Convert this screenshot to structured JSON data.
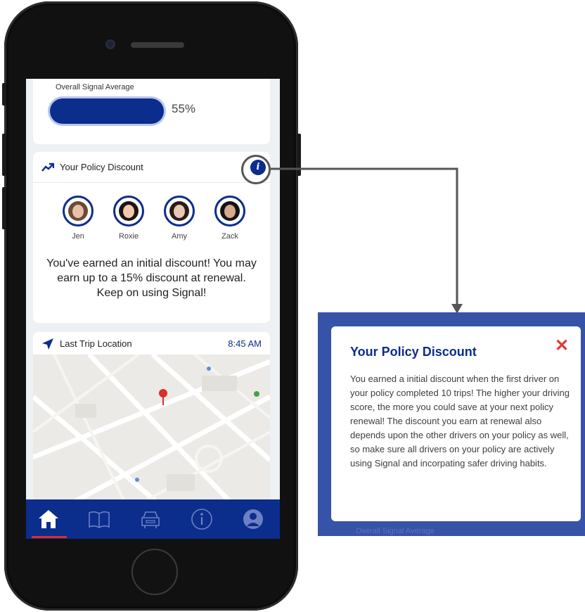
{
  "signal": {
    "title": "Overall Signal Average",
    "percent_label": "55%",
    "progress": 0.55
  },
  "policy_card": {
    "title": "Your Policy Discount",
    "drivers": [
      "Jen",
      "Roxie",
      "Amy",
      "Zack"
    ],
    "message": "You've earned an initial discount! You may earn up to a 15% discount at renewal. Keep on using Signal!"
  },
  "trip_card": {
    "title": "Last Trip  Location",
    "time": "8:45 AM"
  },
  "tabs": [
    "home-icon",
    "book-icon",
    "car-icon",
    "info-icon",
    "profile-icon"
  ],
  "popup": {
    "title": "Your Policy Discount",
    "close_label": "✕",
    "body": "You earned a initial discount when the first driver on your policy completed 10 trips! The higher your driving score, the more you could save at your next policy renewal! The discount you earn at renewal also depends upon the other drivers on your policy as well, so make sure all drivers on your policy are actively using Signal and incorpating safer driving habits.",
    "ghost_text": "Overall Signal Average"
  },
  "colors": {
    "brand_blue": "#0b2d8c",
    "popup_blue": "#3753a8",
    "close_red": "#e03a36",
    "active_tab_underline": "#d9302c"
  }
}
